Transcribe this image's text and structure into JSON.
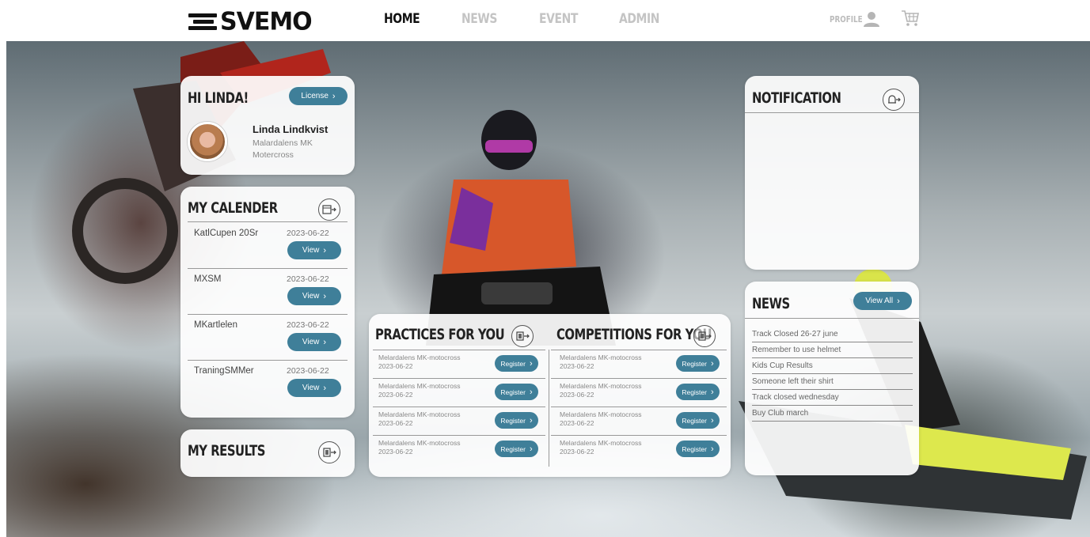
{
  "nav": {
    "logo_text": "SVEMO",
    "items": [
      {
        "label": "HOME",
        "active": true
      },
      {
        "label": "NEWS",
        "active": false
      },
      {
        "label": "EVENT",
        "active": false
      },
      {
        "label": "ADMIN",
        "active": false
      }
    ],
    "profile_label": "PROFILE",
    "profile_icon": "user-icon",
    "cart_icon": "cart-icon"
  },
  "greeting": {
    "title": "HI LINDA!",
    "license_button": "License",
    "name": "Linda Lindkvist",
    "club": "Malardalens MK Motercross"
  },
  "calendar": {
    "title": "MY CALENDER",
    "icon": "calendar-arrow-icon",
    "view_label": "View",
    "events": [
      {
        "name": "KatlCupen 20Sr",
        "date": "2023-06-22"
      },
      {
        "name": "MXSM",
        "date": "2023-06-22"
      },
      {
        "name": "MKartlelen",
        "date": "2023-06-22"
      },
      {
        "name": "TraningSMMer",
        "date": "2023-06-22"
      }
    ]
  },
  "results": {
    "title": "MY RESULTS",
    "icon": "results-arrow-icon"
  },
  "practices": {
    "title": "PRACTICES FOR YOU",
    "icon": "practice-arrow-icon",
    "register_label": "Register",
    "items": [
      {
        "club": "Melardalens MK-motocross",
        "date": "2023-06-22"
      },
      {
        "club": "Melardalens MK-motocross",
        "date": "2023-06-22"
      },
      {
        "club": "Melardalens MK-motocross",
        "date": "2023-06-22"
      },
      {
        "club": "Melardalens MK-motocross",
        "date": "2023-06-22"
      }
    ]
  },
  "competitions": {
    "title": "COMPETITIONS FOR YOU",
    "icon": "competition-arrow-icon",
    "register_label": "Register",
    "items": [
      {
        "club": "Melardalens MK-motocross",
        "date": "2023-06-22"
      },
      {
        "club": "Melardalens MK-motocross",
        "date": "2023-06-22"
      },
      {
        "club": "Melardalens MK-motocross",
        "date": "2023-06-22"
      },
      {
        "club": "Melardalens MK-motocross",
        "date": "2023-06-22"
      }
    ]
  },
  "notification": {
    "title": "NOTIFICATION",
    "icon": "bell-arrow-icon"
  },
  "news": {
    "title": "NEWS",
    "view_all": "View All",
    "items": [
      "Track Closed 26-27 june",
      "Remember to use helmet",
      "Kids Cup Results",
      "Someone left their shirt",
      "Track closed wednesday",
      "Buy Club march"
    ]
  },
  "colors": {
    "accent": "#3f7f99",
    "nav_active": "#111111",
    "nav_inactive": "#c4c4c4"
  }
}
